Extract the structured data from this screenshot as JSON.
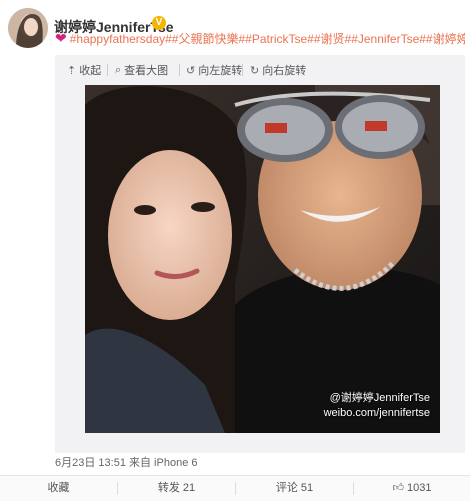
{
  "post": {
    "username": "谢婷婷JenniferTse",
    "verified_badge": "V",
    "text": "#happyfathersday##父親節快樂##PatrickTse##谢贤##JenniferTse##谢婷婷#",
    "heart_icon": "heart-icon",
    "timestamp": "6月23日 13:51",
    "source": "来自 iPhone 6"
  },
  "toolbar": {
    "collapse": "收起",
    "view_large": "查看大图",
    "rotate_left": "向左旋转",
    "rotate_right": "向右旋转"
  },
  "photo": {
    "watermark_name": "@谢婷婷JenniferTse",
    "watermark_url": "weibo.com/jennifertse"
  },
  "actions": {
    "favorite": "收藏",
    "repost": "转发 21",
    "comment": "评论 51",
    "like": "1031"
  },
  "colors": {
    "hashtag": "#eb7350",
    "badge": "#f5b400"
  }
}
